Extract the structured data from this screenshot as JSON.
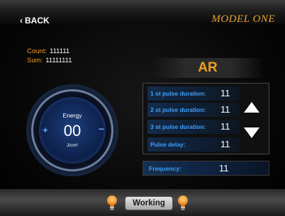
{
  "header": {
    "back_label": "BACK",
    "model_name": "MODEL ONE"
  },
  "counters": {
    "count_label": "Count:",
    "count_value": "111111",
    "sum_label": "Sum:",
    "sum_value": "11111111"
  },
  "energy": {
    "label": "Energy",
    "value": "00",
    "unit": "J/cm²",
    "plus_symbol": "+",
    "minus_symbol": "−"
  },
  "mode": {
    "title": "AR"
  },
  "params": [
    {
      "label": "1 st pulse duration:",
      "value": "11"
    },
    {
      "label": "2 st pulse duration:",
      "value": "11"
    },
    {
      "label": "3 st pulse duration:",
      "value": "11"
    },
    {
      "label": "Pulse delay:",
      "value": "11"
    }
  ],
  "frequency": {
    "label": "Frequency:",
    "value": "11"
  },
  "footer": {
    "status_button_label": "Working"
  },
  "icons": {
    "back": "chevron-left-icon",
    "increase": "arrow-up-icon",
    "decrease": "arrow-down-icon",
    "status": "lightbulb-icon"
  },
  "colors": {
    "accent_orange": "#f0a020",
    "label_blue": "#3fa2ff",
    "dial_blue": "#0f2452"
  }
}
